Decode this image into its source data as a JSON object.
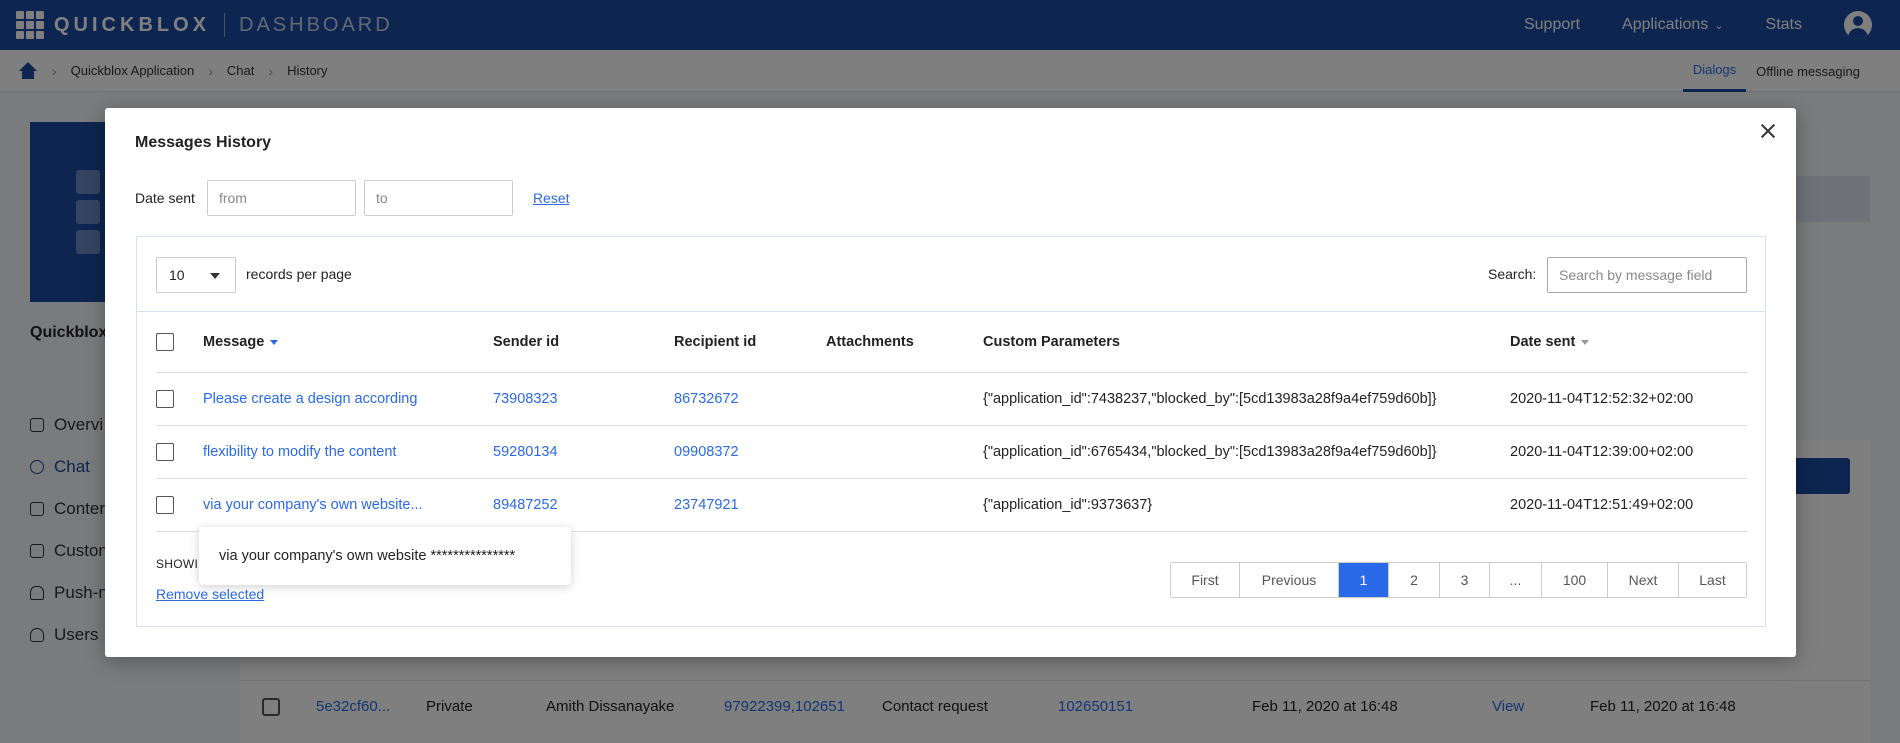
{
  "app": {
    "brand": "QUICKBLOX",
    "brand_sub": "DASHBOARD",
    "nav": {
      "support": "Support",
      "applications": "Applications",
      "stats": "Stats"
    }
  },
  "breadcrumb": [
    "Quickblox Application",
    "Chat",
    "History"
  ],
  "subtabs": {
    "dialogs": "Dialogs",
    "offline": "Offline messaging"
  },
  "sidebar": {
    "title": "Quickblox",
    "items": [
      "Overvi",
      "Chat",
      "Conter",
      "Custon",
      "Push-n",
      "Users"
    ]
  },
  "background_rows": [
    {
      "id": "5e32cf60...",
      "type": "Private",
      "name": "Amith Dissanayake",
      "occupants": "97922399,102651",
      "dialog_name": "Contact request",
      "user": "102650151",
      "created": "Feb 11, 2020 at 16:48",
      "action": "View",
      "updated": "Feb 11, 2020 at 16:48"
    }
  ],
  "modal": {
    "title": "Messages History",
    "date_sent_label": "Date sent",
    "from_placeholder": "from",
    "to_placeholder": "to",
    "reset": "Reset",
    "per_page_value": "10",
    "per_page_label": "records per page",
    "search_label": "Search:",
    "search_placeholder": "Search by message field",
    "columns": {
      "message": "Message",
      "sender": "Sender id",
      "recipient": "Recipient id",
      "attachments": "Attachments",
      "custom": "Custom Parameters",
      "date": "Date sent"
    },
    "rows": [
      {
        "message": "Please create a design according",
        "sender": "73908323",
        "recipient": "86732672",
        "attachments": "",
        "custom": "{\"application_id\":7438237,\"blocked_by\":[5cd13983a28f9a4ef759d60b]}",
        "date": "2020-11-04T12:52:32+02:00"
      },
      {
        "message": "flexibility to modify the content",
        "sender": "59280134",
        "recipient": "09908372",
        "attachments": "",
        "custom": "{\"application_id\":6765434,\"blocked_by\":[5cd13983a28f9a4ef759d60b]}",
        "date": "2020-11-04T12:39:00+02:00"
      },
      {
        "message": "via your company's own website...",
        "sender": "89487252",
        "recipient": "23747921",
        "attachments": "",
        "custom": "{\"application_id\":9373637}",
        "date": "2020-11-04T12:51:49+02:00"
      }
    ],
    "tooltip": "via your company's own website ***************",
    "showing": "SHOWIN",
    "remove_selected": "Remove selected",
    "pagination": [
      "First",
      "Previous",
      "1",
      "2",
      "3",
      "...",
      "100",
      "Next",
      "Last"
    ],
    "active_page": "1"
  },
  "colors": {
    "brand": "#1b4aa1",
    "accent": "#2a6ae8"
  }
}
